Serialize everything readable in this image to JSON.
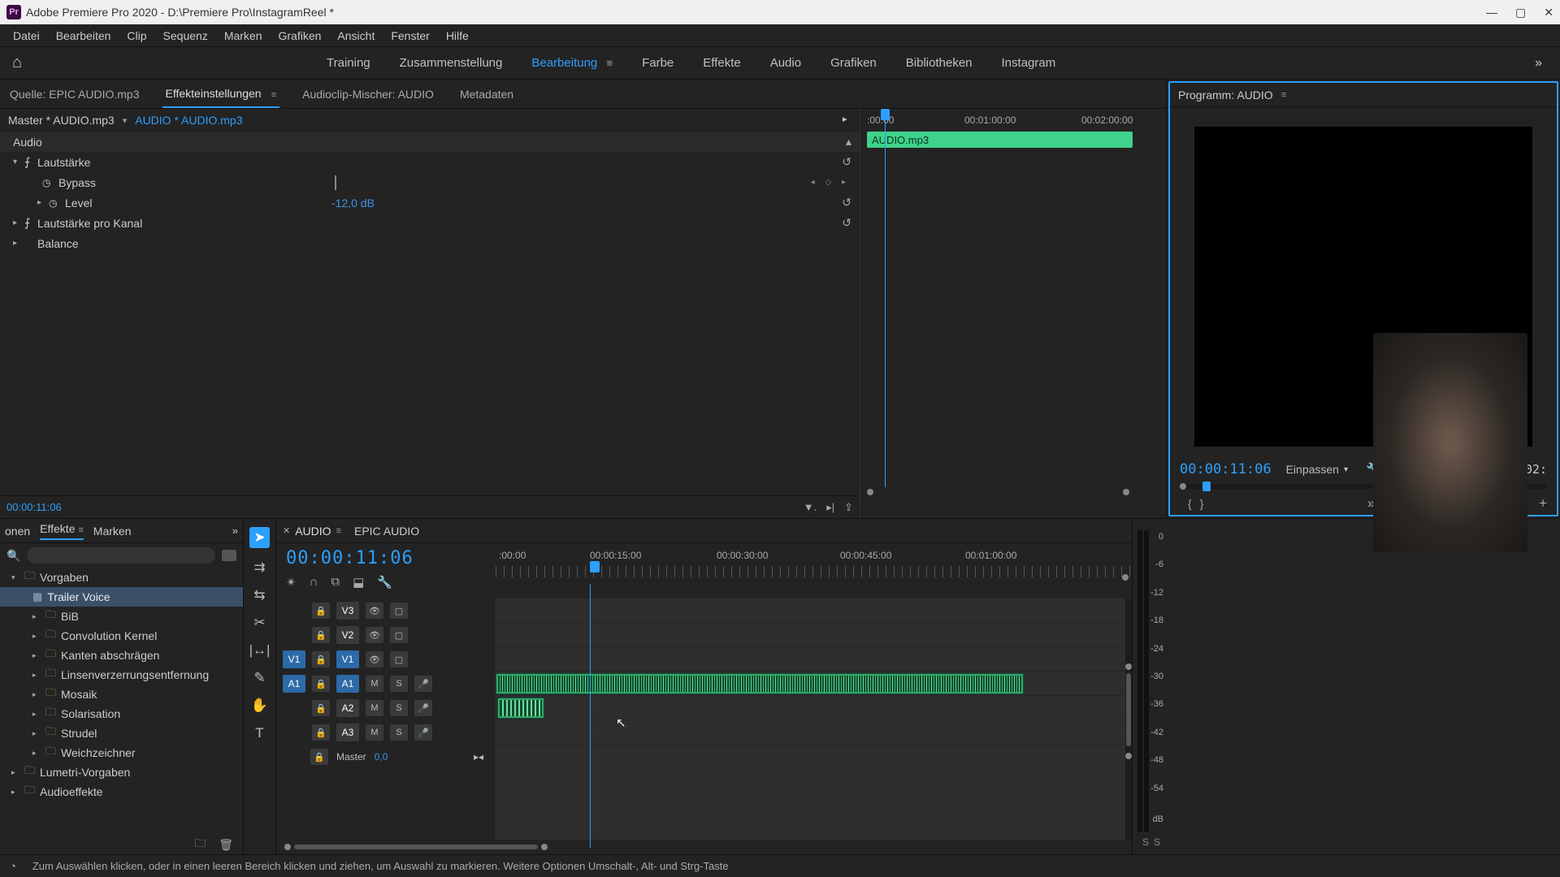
{
  "window": {
    "title": "Adobe Premiere Pro 2020 - D:\\Premiere Pro\\InstagramReel *"
  },
  "menus": [
    "Datei",
    "Bearbeiten",
    "Clip",
    "Sequenz",
    "Marken",
    "Grafiken",
    "Ansicht",
    "Fenster",
    "Hilfe"
  ],
  "workspaces": {
    "items": [
      "Training",
      "Zusammenstellung",
      "Bearbeitung",
      "Farbe",
      "Effekte",
      "Audio",
      "Grafiken",
      "Bibliotheken",
      "Instagram"
    ],
    "active": "Bearbeitung"
  },
  "source_tabs": {
    "quelle": "Quelle: EPIC AUDIO.mp3",
    "effect_controls": "Effekteinstellungen",
    "audio_mixer": "Audioclip-Mischer: AUDIO",
    "metadata": "Metadaten"
  },
  "effect_controls": {
    "master": "Master * AUDIO.mp3",
    "clip": "AUDIO * AUDIO.mp3",
    "section": "Audio",
    "volume": {
      "label": "Lautstärke",
      "bypass": "Bypass",
      "level_label": "Level",
      "level_value": "-12,0 dB"
    },
    "channel_volume": "Lautstärke pro Kanal",
    "balance": "Balance",
    "timeruler": {
      "t0": ":00:00",
      "t1": "00:01:00:00",
      "t2": "00:02:00:00"
    },
    "clipbar": "AUDIO.mp3",
    "timecode": "00:00:11:06"
  },
  "program": {
    "title": "Programm: AUDIO",
    "timecode": "00:00:11:06",
    "zoom": "Einpassen",
    "right_tc": "00:02:"
  },
  "effects_browser": {
    "tabs": {
      "onen": "onen",
      "effekte": "Effekte",
      "marken": "Marken"
    },
    "tree": {
      "root": "Vorgaben",
      "selected": "Trailer Voice",
      "items": [
        "BiB",
        "Convolution Kernel",
        "Kanten abschrägen",
        "Linsenverzerrungsentfernung",
        "Mosaik",
        "Solarisation",
        "Strudel",
        "Weichzeichner"
      ],
      "lumetri": "Lumetri-Vorgaben",
      "audiofx": "Audioeffekte"
    }
  },
  "timeline": {
    "tabs": {
      "active": "AUDIO",
      "other": "EPIC AUDIO"
    },
    "timecode": "00:00:11:06",
    "ruler": {
      "t0": ":00:00",
      "t1": "00:00:15:00",
      "t2": "00:00:30:00",
      "t3": "00:00:45:00",
      "t4": "00:01:00:00"
    },
    "tracks": {
      "v3": "V3",
      "v2": "V2",
      "v1": "V1",
      "a1": "A1",
      "a2": "A2",
      "a3": "A3",
      "src_v1": "V1",
      "src_a1": "A1",
      "master": "Master",
      "master_val": "0,0",
      "m": "M",
      "s": "S"
    }
  },
  "meters": {
    "labels": [
      "0",
      "-6",
      "-12",
      "-18",
      "-24",
      "-30",
      "-36",
      "-42",
      "-48",
      "-54",
      "dB"
    ]
  },
  "status": {
    "text": "Zum Auswählen klicken, oder in einen leeren Bereich klicken und ziehen, um Auswahl zu markieren. Weitere Optionen Umschalt-, Alt- und Strg-Taste"
  }
}
